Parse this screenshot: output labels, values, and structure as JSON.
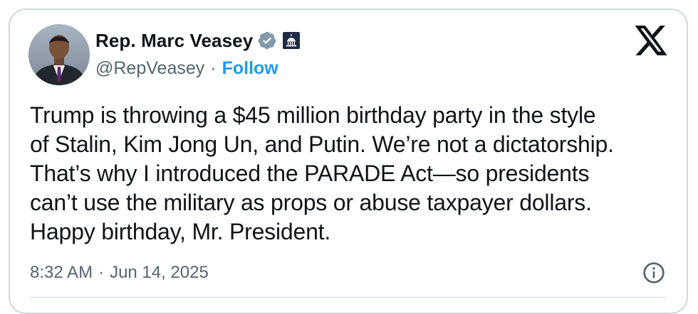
{
  "author": {
    "name": "Rep. Marc Veasey",
    "handle": "@RepVeasey",
    "separator": "·",
    "follow_label": "Follow",
    "verified_icon": "verified-badge-icon",
    "affiliation_icon": "capitol-badge-icon"
  },
  "tweet": {
    "lines": [
      "Trump is throwing a $45 million birthday party in the style",
      "of Stalin, Kim Jong Un, and Putin. We’re not a dictatorship.",
      "That’s why I introduced the PARADE Act—so presidents",
      "can’t use the military as props or abuse taxpayer dollars.",
      "Happy birthday, Mr. President."
    ]
  },
  "meta": {
    "time": "8:32 AM",
    "separator": "·",
    "date": "Jun 14, 2025"
  },
  "icons": {
    "logo": "x-logo-icon",
    "info": "info-icon"
  },
  "colors": {
    "text": "#0f1419",
    "secondary": "#536471",
    "accent": "#1d9bf0",
    "border": "#cfd9de",
    "verified": "#829aab"
  }
}
